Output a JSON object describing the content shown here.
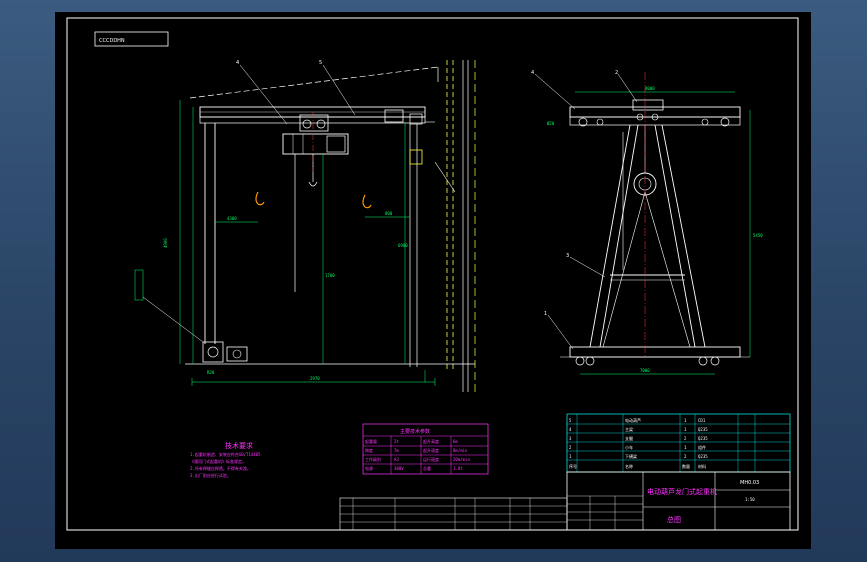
{
  "drawing": {
    "tag_box": "CCCDDHN",
    "colors": {
      "background": "#000000",
      "frame": "#ffffff",
      "structure": "#ffffff",
      "dimension": "#00ff66",
      "centerline": "#ff3b3b",
      "annotation": "#ff33ff",
      "rail": "#ffff44",
      "table_lines": "#00ffff"
    },
    "side_view": {
      "leaders": [
        "4",
        "5"
      ],
      "dims": [
        "2970",
        "4900",
        "4300",
        "1700",
        "800",
        "6900",
        "R20"
      ]
    },
    "front_view": {
      "leaders": [
        "4",
        "2",
        "3",
        "1"
      ],
      "dims": [
        "4000",
        "7000",
        "5450",
        "Ø20"
      ]
    },
    "notes": {
      "title": "技术要求",
      "lines": [
        "1.起重机制造、安装应符合GB/T14405",
        "  《通用门式起重机》标准规定。",
        "2.所有焊缝应焊透，不得有夹渣。",
        "3.出厂前应进行试验。"
      ]
    },
    "spec_table": {
      "title": "主要技术参数",
      "rows": [
        [
          "起重量",
          "2t",
          "起升高度",
          "6m"
        ],
        [
          "跨度",
          "7m",
          "起升速度",
          "8m/min"
        ],
        [
          "工作级别",
          "A3",
          "运行速度",
          "20m/min"
        ],
        [
          "电源",
          "380V",
          "总重",
          "1.8t"
        ]
      ]
    },
    "bom": {
      "rows": [
        [
          "5",
          "电动葫芦",
          "1",
          "CD1"
        ],
        [
          "4",
          "主梁",
          "1",
          "Q235"
        ],
        [
          "3",
          "支腿",
          "2",
          "Q235"
        ],
        [
          "2",
          "小车",
          "1",
          "组件"
        ],
        [
          "1",
          "下横梁",
          "2",
          "Q235"
        ]
      ],
      "header": [
        "序号",
        "名称",
        "数量",
        "材料"
      ]
    },
    "title_block": {
      "title": "电动葫芦龙门式起重机",
      "drawing_no": "MH0.03",
      "label": "总图",
      "scale": "1:50"
    }
  }
}
